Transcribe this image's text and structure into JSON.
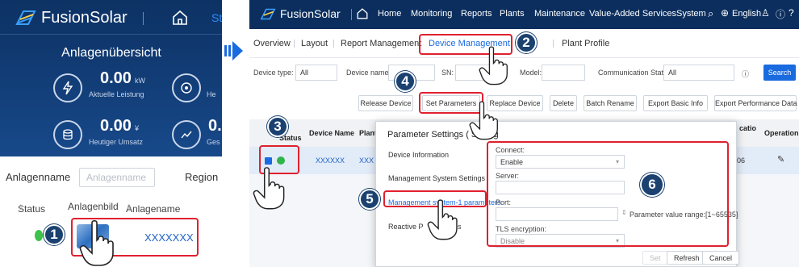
{
  "mobile": {
    "brand": "FusionSolar",
    "tab_partial": "St",
    "title": "Anlagenübersicht",
    "kpis": [
      {
        "value": "0.00",
        "unit": "kW",
        "label": "Aktuelle Leistung",
        "icon": "lightning-icon",
        "clipped_label": "He"
      },
      {
        "value": "0.00",
        "unit": "¥",
        "label": "Heutiger Umsatz",
        "icon": "coins-icon",
        "clipped_value": "0.",
        "clipped_label": "Ges"
      }
    ],
    "filter": {
      "label": "Anlagenname",
      "placeholder": "Anlagenname",
      "region_label": "Region"
    },
    "columns": [
      "Status",
      "Anlagenbild",
      "Anlagename"
    ],
    "row": {
      "plant_name": "XXXXXXX"
    }
  },
  "web": {
    "brand": "FusionSolar",
    "menu": [
      "Home",
      "Monitoring",
      "Reports",
      "Plants",
      "Maintenance",
      "Value-Added Services",
      "System"
    ],
    "language": "English",
    "subtabs": [
      "Overview",
      "Layout",
      "Report Management",
      "Device Management",
      "s",
      "Plant Profile"
    ],
    "active_subtab": "Device Management",
    "filters": {
      "device_type_label": "Device type:",
      "device_type_value": "All",
      "device_name_label": "Device name:",
      "sn_label": "SN:",
      "model_label": "Model:",
      "comm_status_label": "Communication Status:",
      "comm_status_value": "All"
    },
    "search_label": "Search",
    "actions": [
      "Release Device",
      "Set Parameters",
      "Replace Device",
      "Delete",
      "Batch Rename",
      "Export Basic Info",
      "Export Performance Data"
    ],
    "table": {
      "headers": {
        "status_top": "e",
        "status_bottom": "Status",
        "device_name": "Device Name",
        "plant": "Plant I",
        "location_partial": "catio",
        "operation": "Operation"
      },
      "row": {
        "device_name": "XXXXXX",
        "plant": "XXX",
        "location_partial": "-06"
      }
    },
    "dialog": {
      "title": "Parameter Settings ( SDong",
      "nav": [
        "Device Information",
        "Management System Settings",
        "Management system-1 parameters",
        "Reactive P",
        "s"
      ],
      "active_nav": "Management system-1 parameters",
      "connect_label": "Connect:",
      "connect_value": "Enable",
      "server_label": "Server:",
      "server_value": "",
      "port_label": "Port:",
      "port_value": "",
      "port_hint": "Parameter value range:[1~65535]",
      "tls_label": "TLS encryption:",
      "tls_value": "Disable",
      "buttons": [
        "Set",
        "Refresh",
        "Cancel"
      ]
    }
  },
  "steps": [
    "1",
    "2",
    "3",
    "4",
    "5",
    "6"
  ],
  "colors": {
    "highlight_red": "#e0202e",
    "badge_navy": "#1b4170",
    "nav_navy": "#0b2e5e",
    "link_blue": "#1a6ae0"
  }
}
